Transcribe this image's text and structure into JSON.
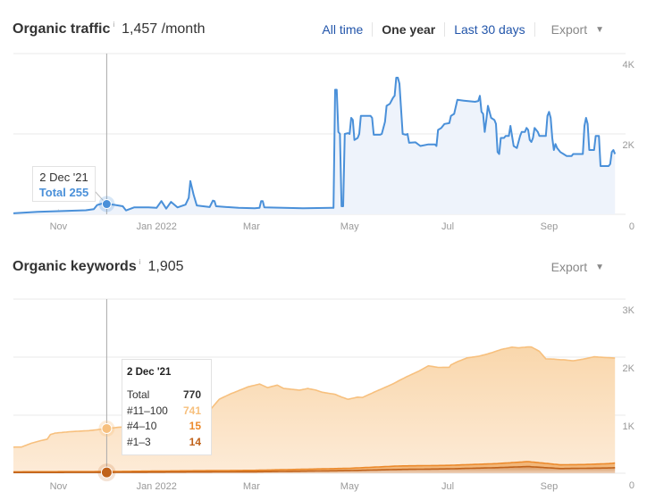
{
  "traffic": {
    "title": "Organic traffic",
    "info": "i",
    "metric": "1,457 /month",
    "ranges": [
      {
        "label": "All time",
        "active": false
      },
      {
        "label": "One year",
        "active": true
      },
      {
        "label": "Last 30 days",
        "active": false
      }
    ],
    "export_label": "Export",
    "caret": "▼",
    "tooltip": {
      "date": "2 Dec '21",
      "label": "Total",
      "value": "255",
      "total_text": "Total 255"
    }
  },
  "keywords": {
    "title": "Organic keywords",
    "info": "i",
    "metric": "1,905",
    "export_label": "Export",
    "caret": "▼",
    "tooltip": {
      "date": "2 Dec '21",
      "rows": [
        {
          "label": "Total",
          "value": "770"
        },
        {
          "label": "#11–100",
          "value": "741"
        },
        {
          "label": "#4–10",
          "value": "15"
        },
        {
          "label": "#1–3",
          "value": "14"
        }
      ]
    }
  },
  "colors": {
    "traffic_line": "#4a90d9",
    "traffic_fill": "#eef3fb",
    "kw_11_100": "#f7c07e",
    "kw_4_10": "#ec8a2c",
    "kw_1_3": "#c0621a",
    "link": "#2255aa"
  },
  "chart_data": [
    {
      "type": "area",
      "title": "Organic traffic",
      "x_start": "2021-10-04",
      "x_end": "2022-10-05",
      "x_unit": "days since start",
      "xticks": [
        {
          "label": "Nov",
          "day": 28
        },
        {
          "label": "Jan 2022",
          "day": 89
        },
        {
          "label": "Mar",
          "day": 148
        },
        {
          "label": "May",
          "day": 209
        },
        {
          "label": "Jul",
          "day": 270
        },
        {
          "label": "Sep",
          "day": 333
        }
      ],
      "yticks": [
        {
          "label": "0",
          "value": 0
        },
        {
          "label": "2K",
          "value": 2000
        },
        {
          "label": "4K",
          "value": 4000
        }
      ],
      "ylim": [
        0,
        4000
      ],
      "grid": true,
      "highlight": {
        "day": 58,
        "label": "2 Dec '21",
        "value": 255
      },
      "series": [
        {
          "name": "Total",
          "points": [
            [
              0,
              25
            ],
            [
              15,
              60
            ],
            [
              30,
              80
            ],
            [
              45,
              100
            ],
            [
              50,
              130
            ],
            [
              52,
              230
            ],
            [
              55,
              265
            ],
            [
              58,
              255
            ],
            [
              62,
              240
            ],
            [
              68,
              200
            ],
            [
              70,
              95
            ],
            [
              75,
              170
            ],
            [
              84,
              170
            ],
            [
              89,
              160
            ],
            [
              92,
              330
            ],
            [
              95,
              140
            ],
            [
              98,
              310
            ],
            [
              102,
              170
            ],
            [
              107,
              240
            ],
            [
              109,
              410
            ],
            [
              110,
              830
            ],
            [
              112,
              490
            ],
            [
              114,
              220
            ],
            [
              122,
              180
            ],
            [
              124,
              340
            ],
            [
              125,
              330
            ],
            [
              126,
              200
            ],
            [
              140,
              160
            ],
            [
              150,
              150
            ],
            [
              153,
              160
            ],
            [
              154,
              330
            ],
            [
              155,
              330
            ],
            [
              156,
              170
            ],
            [
              180,
              150
            ],
            [
              198,
              160
            ],
            [
              199,
              160
            ],
            [
              200,
              3100
            ],
            [
              201,
              3100
            ],
            [
              202,
              2050
            ],
            [
              203,
              2000
            ],
            [
              204,
              200
            ],
            [
              205,
              200
            ],
            [
              206,
              2000
            ],
            [
              208,
              2020
            ],
            [
              209,
              2000
            ],
            [
              210,
              2400
            ],
            [
              211,
              2350
            ],
            [
              212,
              1850
            ],
            [
              214,
              1900
            ],
            [
              215,
              2000
            ],
            [
              216,
              2450
            ],
            [
              222,
              2450
            ],
            [
              223,
              2400
            ],
            [
              224,
              1980
            ],
            [
              228,
              1980
            ],
            [
              229,
              2000
            ],
            [
              231,
              2300
            ],
            [
              232,
              2700
            ],
            [
              234,
              2750
            ],
            [
              236,
              2900
            ],
            [
              237,
              2950
            ],
            [
              238,
              3400
            ],
            [
              239,
              3400
            ],
            [
              240,
              3250
            ],
            [
              242,
              2000
            ],
            [
              244,
              1980
            ],
            [
              245,
              2000
            ],
            [
              246,
              1780
            ],
            [
              250,
              1790
            ],
            [
              253,
              1700
            ],
            [
              258,
              1740
            ],
            [
              262,
              1740
            ],
            [
              263,
              1700
            ],
            [
              264,
              2100
            ],
            [
              266,
              2150
            ],
            [
              268,
              2250
            ],
            [
              271,
              2270
            ],
            [
              272,
              2450
            ],
            [
              274,
              2500
            ],
            [
              276,
              2850
            ],
            [
              280,
              2830
            ],
            [
              287,
              2800
            ],
            [
              289,
              2820
            ],
            [
              290,
              2950
            ],
            [
              291,
              2550
            ],
            [
              292,
              2500
            ],
            [
              293,
              2050
            ],
            [
              294,
              2350
            ],
            [
              295,
              2700
            ],
            [
              297,
              2400
            ],
            [
              299,
              2350
            ],
            [
              300,
              2250
            ],
            [
              301,
              1550
            ],
            [
              302,
              1500
            ],
            [
              303,
              1900
            ],
            [
              305,
              1900
            ],
            [
              306,
              1950
            ],
            [
              308,
              1950
            ],
            [
              309,
              2200
            ],
            [
              310,
              1950
            ],
            [
              311,
              1700
            ],
            [
              313,
              1650
            ],
            [
              315,
              1950
            ],
            [
              316,
              2050
            ],
            [
              318,
              2050
            ],
            [
              319,
              2150
            ],
            [
              320,
              2100
            ],
            [
              321,
              1850
            ],
            [
              322,
              1800
            ],
            [
              323,
              1900
            ],
            [
              324,
              2150
            ],
            [
              326,
              2050
            ],
            [
              327,
              1950
            ],
            [
              330,
              1950
            ],
            [
              331,
              1950
            ],
            [
              332,
              2450
            ],
            [
              333,
              2550
            ],
            [
              334,
              2400
            ],
            [
              335,
              1900
            ],
            [
              336,
              1600
            ],
            [
              337,
              1750
            ],
            [
              338,
              1650
            ],
            [
              340,
              1550
            ],
            [
              342,
              1500
            ],
            [
              344,
              1450
            ],
            [
              347,
              1450
            ],
            [
              348,
              1500
            ],
            [
              352,
              1500
            ],
            [
              354,
              1500
            ],
            [
              355,
              2200
            ],
            [
              356,
              2400
            ],
            [
              357,
              2250
            ],
            [
              358,
              1600
            ],
            [
              361,
              1600
            ],
            [
              362,
              1950
            ],
            [
              364,
              1950
            ],
            [
              365,
              1200
            ],
            [
              370,
              1200
            ],
            [
              371,
              1250
            ],
            [
              372,
              1550
            ],
            [
              373,
              1600
            ],
            [
              374,
              1500
            ]
          ]
        }
      ]
    },
    {
      "type": "area",
      "stacked": true,
      "title": "Organic keywords",
      "x_start": "2021-10-04",
      "x_end": "2022-10-05",
      "x_unit": "days since start",
      "xticks": [
        {
          "label": "Nov",
          "day": 28
        },
        {
          "label": "Jan 2022",
          "day": 89
        },
        {
          "label": "Mar",
          "day": 148
        },
        {
          "label": "May",
          "day": 209
        },
        {
          "label": "Jul",
          "day": 270
        },
        {
          "label": "Sep",
          "day": 333
        }
      ],
      "yticks": [
        {
          "label": "0",
          "value": 0
        },
        {
          "label": "1K",
          "value": 1000
        },
        {
          "label": "2K",
          "value": 2000
        },
        {
          "label": "3K",
          "value": 3000
        }
      ],
      "ylim": [
        0,
        3000
      ],
      "grid": true,
      "highlight": {
        "day": 58,
        "label": "2 Dec '21",
        "total": 770,
        "values": {
          "#11–100": 741,
          "#4–10": 15,
          "#1–3": 14
        }
      },
      "series": [
        {
          "name": "#1–3",
          "points": [
            [
              0,
              12
            ],
            [
              58,
              14
            ],
            [
              100,
              20
            ],
            [
              150,
              25
            ],
            [
              209,
              45
            ],
            [
              240,
              65
            ],
            [
              270,
              75
            ],
            [
              300,
              95
            ],
            [
              320,
              115
            ],
            [
              340,
              80
            ],
            [
              355,
              85
            ],
            [
              370,
              90
            ],
            [
              374,
              95
            ]
          ]
        },
        {
          "name": "#4–10",
          "points": [
            [
              0,
              13
            ],
            [
              58,
              15
            ],
            [
              100,
              20
            ],
            [
              150,
              25
            ],
            [
              209,
              40
            ],
            [
              240,
              60
            ],
            [
              270,
              60
            ],
            [
              300,
              70
            ],
            [
              320,
              85
            ],
            [
              340,
              65
            ],
            [
              355,
              65
            ],
            [
              370,
              75
            ],
            [
              374,
              80
            ]
          ]
        },
        {
          "name": "#11–100",
          "points": [
            [
              0,
              425
            ],
            [
              5,
              425
            ],
            [
              11,
              490
            ],
            [
              17,
              535
            ],
            [
              21,
              560
            ],
            [
              23,
              640
            ],
            [
              26,
              665
            ],
            [
              36,
              690
            ],
            [
              47,
              705
            ],
            [
              58,
              741
            ],
            [
              69,
              770
            ],
            [
              83,
              900
            ],
            [
              105,
              1000
            ],
            [
              123,
              1070
            ],
            [
              128,
              1230
            ],
            [
              135,
              1320
            ],
            [
              146,
              1440
            ],
            [
              153,
              1485
            ],
            [
              158,
              1420
            ],
            [
              164,
              1460
            ],
            [
              168,
              1400
            ],
            [
              178,
              1365
            ],
            [
              183,
              1390
            ],
            [
              188,
              1360
            ],
            [
              192,
              1320
            ],
            [
              200,
              1280
            ],
            [
              204,
              1230
            ],
            [
              208,
              1190
            ],
            [
              214,
              1220
            ],
            [
              217,
              1210
            ],
            [
              225,
              1300
            ],
            [
              236,
              1420
            ],
            [
              244,
              1530
            ],
            [
              252,
              1630
            ],
            [
              258,
              1720
            ],
            [
              264,
              1690
            ],
            [
              271,
              1690
            ],
            [
              272,
              1730
            ],
            [
              276,
              1780
            ],
            [
              282,
              1840
            ],
            [
              289,
              1860
            ],
            [
              294,
              1890
            ],
            [
              298,
              1920
            ],
            [
              303,
              1960
            ],
            [
              310,
              1990
            ],
            [
              314,
              1970
            ],
            [
              322,
              1980
            ],
            [
              327,
              1920
            ],
            [
              331,
              1800
            ],
            [
              336,
              1810
            ],
            [
              342,
              1810
            ],
            [
              348,
              1790
            ],
            [
              355,
              1820
            ],
            [
              361,
              1850
            ],
            [
              370,
              1825
            ],
            [
              374,
              1810
            ]
          ]
        }
      ]
    }
  ]
}
